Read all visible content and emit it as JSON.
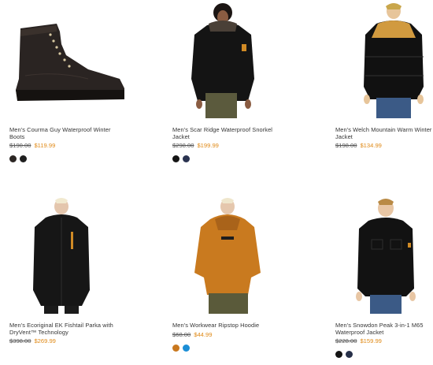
{
  "products": [
    {
      "title": "Men's Courma Guy Waterproof Winter Boots",
      "old_price": "$190.00",
      "sale_price": "$119.99",
      "swatches": [
        "#2b2623",
        "#1f1f1f"
      ]
    },
    {
      "title": "Men's Scar Ridge Waterproof Snorkel Jacket",
      "old_price": "$298.00",
      "sale_price": "$199.99",
      "swatches": [
        "#151515",
        "#2a3350"
      ]
    },
    {
      "title": "Men's Welch Mountain Warm Winter Jacket",
      "old_price": "$198.00",
      "sale_price": "$134.99",
      "swatches": []
    },
    {
      "title": "Men's Ecoriginal EK Fishtail Parka with DryVent™ Technology",
      "old_price": "$398.00",
      "sale_price": "$269.99",
      "swatches": []
    },
    {
      "title": "Men's Workwear Ripstop Hoodie",
      "old_price": "$68.00",
      "sale_price": "$44.99",
      "swatches": [
        "#c9781e",
        "#1b8ed6"
      ]
    },
    {
      "title": "Men's Snowdon Peak 3-in-1 M65 Waterproof Jacket",
      "old_price": "$228.00",
      "sale_price": "$159.99",
      "swatches": [
        "#141414",
        "#273049"
      ]
    }
  ],
  "colors": {
    "sale": "#e08a17",
    "old": "#555555"
  },
  "icons": [
    "boot-image",
    "jacket-image"
  ]
}
